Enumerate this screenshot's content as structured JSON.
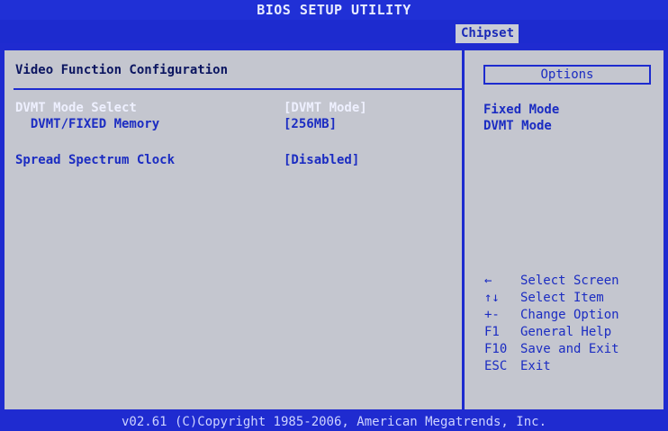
{
  "title": "BIOS SETUP UTILITY",
  "active_tab": "Chipset",
  "section_title": "Video Function Configuration",
  "settings": [
    {
      "label": "DVMT Mode Select",
      "value": "[DVMT Mode]"
    },
    {
      "label": "  DVMT/FIXED Memory",
      "value": "[256MB]"
    },
    {
      "label": "Spread Spectrum Clock",
      "value": "[Disabled]"
    }
  ],
  "options_header": "Options",
  "options": [
    "Fixed Mode",
    "DVMT Mode"
  ],
  "help_keys": [
    {
      "key": "←",
      "desc": "Select Screen"
    },
    {
      "key": "↑↓",
      "desc": "Select Item"
    },
    {
      "key": "+-",
      "desc": "Change Option"
    },
    {
      "key": "F1",
      "desc": "General Help"
    },
    {
      "key": "F10",
      "desc": "Save and Exit"
    },
    {
      "key": "ESC",
      "desc": "Exit"
    }
  ],
  "footer": "v02.61 (C)Copyright 1985-2006, American Megatrends, Inc.",
  "colors": {
    "bios_blue": "#1f2bd0",
    "panel_gray": "#c4c6cf",
    "text_blue": "#1b2cc2",
    "highlight_white": "#eef0ff"
  }
}
